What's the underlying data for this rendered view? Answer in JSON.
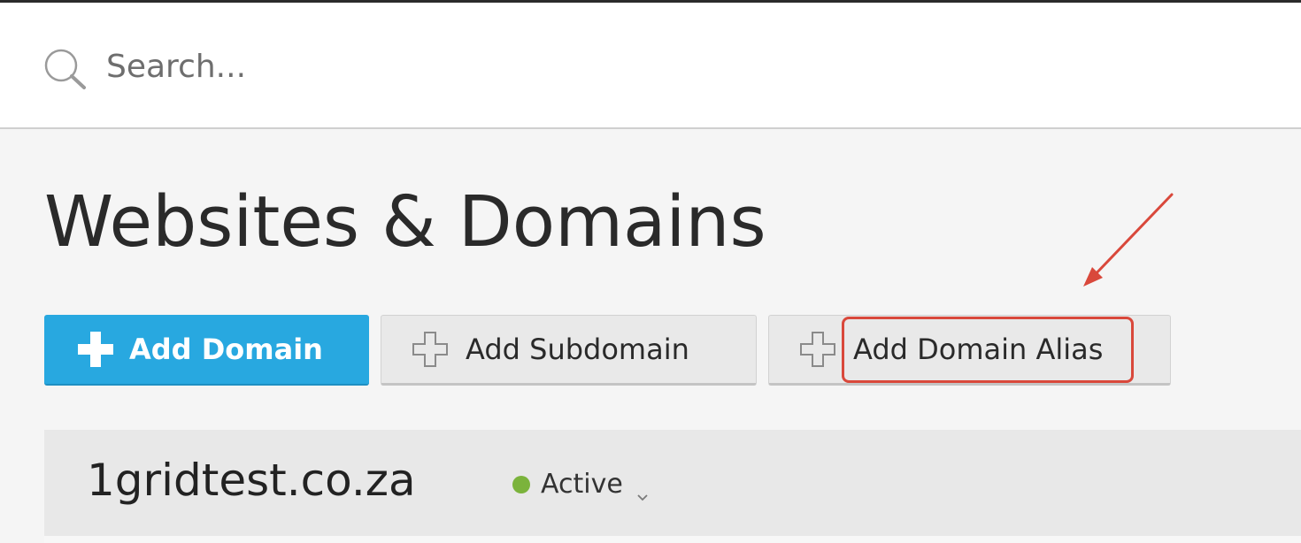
{
  "search": {
    "placeholder": "Search...",
    "icon": "search-icon"
  },
  "page": {
    "title": "Websites & Domains"
  },
  "toolbar": {
    "add_domain_label": "Add Domain",
    "add_subdomain_label": "Add Subdomain",
    "add_domain_alias_label": "Add Domain Alias"
  },
  "domain": {
    "name": "1gridtest.co.za",
    "status": "Active"
  },
  "colors": {
    "primary_button": "#28a8e0",
    "status_active": "#7bb33c",
    "annotation": "#d9483b"
  }
}
